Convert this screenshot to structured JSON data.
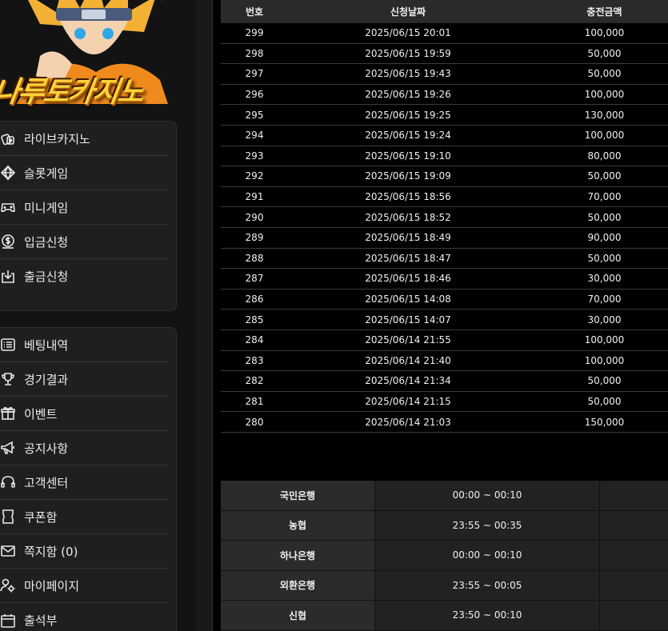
{
  "logo": {
    "text": "나루토카지노"
  },
  "menu_a": [
    {
      "label": "라이브카지노",
      "icon": "live-casino-icon"
    },
    {
      "label": "슬롯게임",
      "icon": "slot-diamond-icon"
    },
    {
      "label": "미니게임",
      "icon": "gamepad-icon"
    },
    {
      "label": "입금신청",
      "icon": "dollar-coin-icon"
    },
    {
      "label": "출금신청",
      "icon": "download-tray-icon"
    }
  ],
  "menu_b": [
    {
      "label": "베팅내역",
      "icon": "list-icon"
    },
    {
      "label": "경기결과",
      "icon": "trophy-icon"
    },
    {
      "label": "이벤트",
      "icon": "gift-icon"
    },
    {
      "label": "공지사항",
      "icon": "megaphone-icon"
    },
    {
      "label": "고객센터",
      "icon": "headset-icon"
    },
    {
      "label": "쿠폰함",
      "icon": "coupon-icon"
    },
    {
      "label": "쪽지함 (0)",
      "icon": "mail-icon"
    },
    {
      "label": "마이페이지",
      "icon": "user-gear-icon"
    },
    {
      "label": "출석부",
      "icon": "calendar-icon"
    }
  ],
  "table": {
    "headers": [
      "번호",
      "신청날짜",
      "충전금액"
    ],
    "rows": [
      [
        "299",
        "2025/06/15 20:01",
        "100,000"
      ],
      [
        "298",
        "2025/06/15 19:59",
        "50,000"
      ],
      [
        "297",
        "2025/06/15 19:43",
        "50,000"
      ],
      [
        "296",
        "2025/06/15 19:26",
        "100,000"
      ],
      [
        "295",
        "2025/06/15 19:25",
        "130,000"
      ],
      [
        "294",
        "2025/06/15 19:24",
        "100,000"
      ],
      [
        "293",
        "2025/06/15 19:10",
        "80,000"
      ],
      [
        "292",
        "2025/06/15 19:09",
        "50,000"
      ],
      [
        "291",
        "2025/06/15 18:56",
        "70,000"
      ],
      [
        "290",
        "2025/06/15 18:52",
        "50,000"
      ],
      [
        "289",
        "2025/06/15 18:49",
        "90,000"
      ],
      [
        "288",
        "2025/06/15 18:47",
        "50,000"
      ],
      [
        "287",
        "2025/06/15 18:46",
        "30,000"
      ],
      [
        "286",
        "2025/06/15 14:08",
        "70,000"
      ],
      [
        "285",
        "2025/06/15 14:07",
        "30,000"
      ],
      [
        "284",
        "2025/06/14 21:55",
        "100,000"
      ],
      [
        "283",
        "2025/06/14 21:40",
        "100,000"
      ],
      [
        "282",
        "2025/06/14 21:34",
        "50,000"
      ],
      [
        "281",
        "2025/06/14 21:15",
        "50,000"
      ],
      [
        "280",
        "2025/06/14 21:03",
        "150,000"
      ]
    ]
  },
  "banks": [
    {
      "name": "국민은행",
      "time": "00:00 ~ 00:10"
    },
    {
      "name": "농협",
      "time": "23:55 ~ 00:35"
    },
    {
      "name": "하나은행",
      "time": "00:00 ~ 00:10"
    },
    {
      "name": "외환은행",
      "time": "23:55 ~ 00:05"
    },
    {
      "name": "신협",
      "time": "23:50 ~ 00:10"
    }
  ]
}
